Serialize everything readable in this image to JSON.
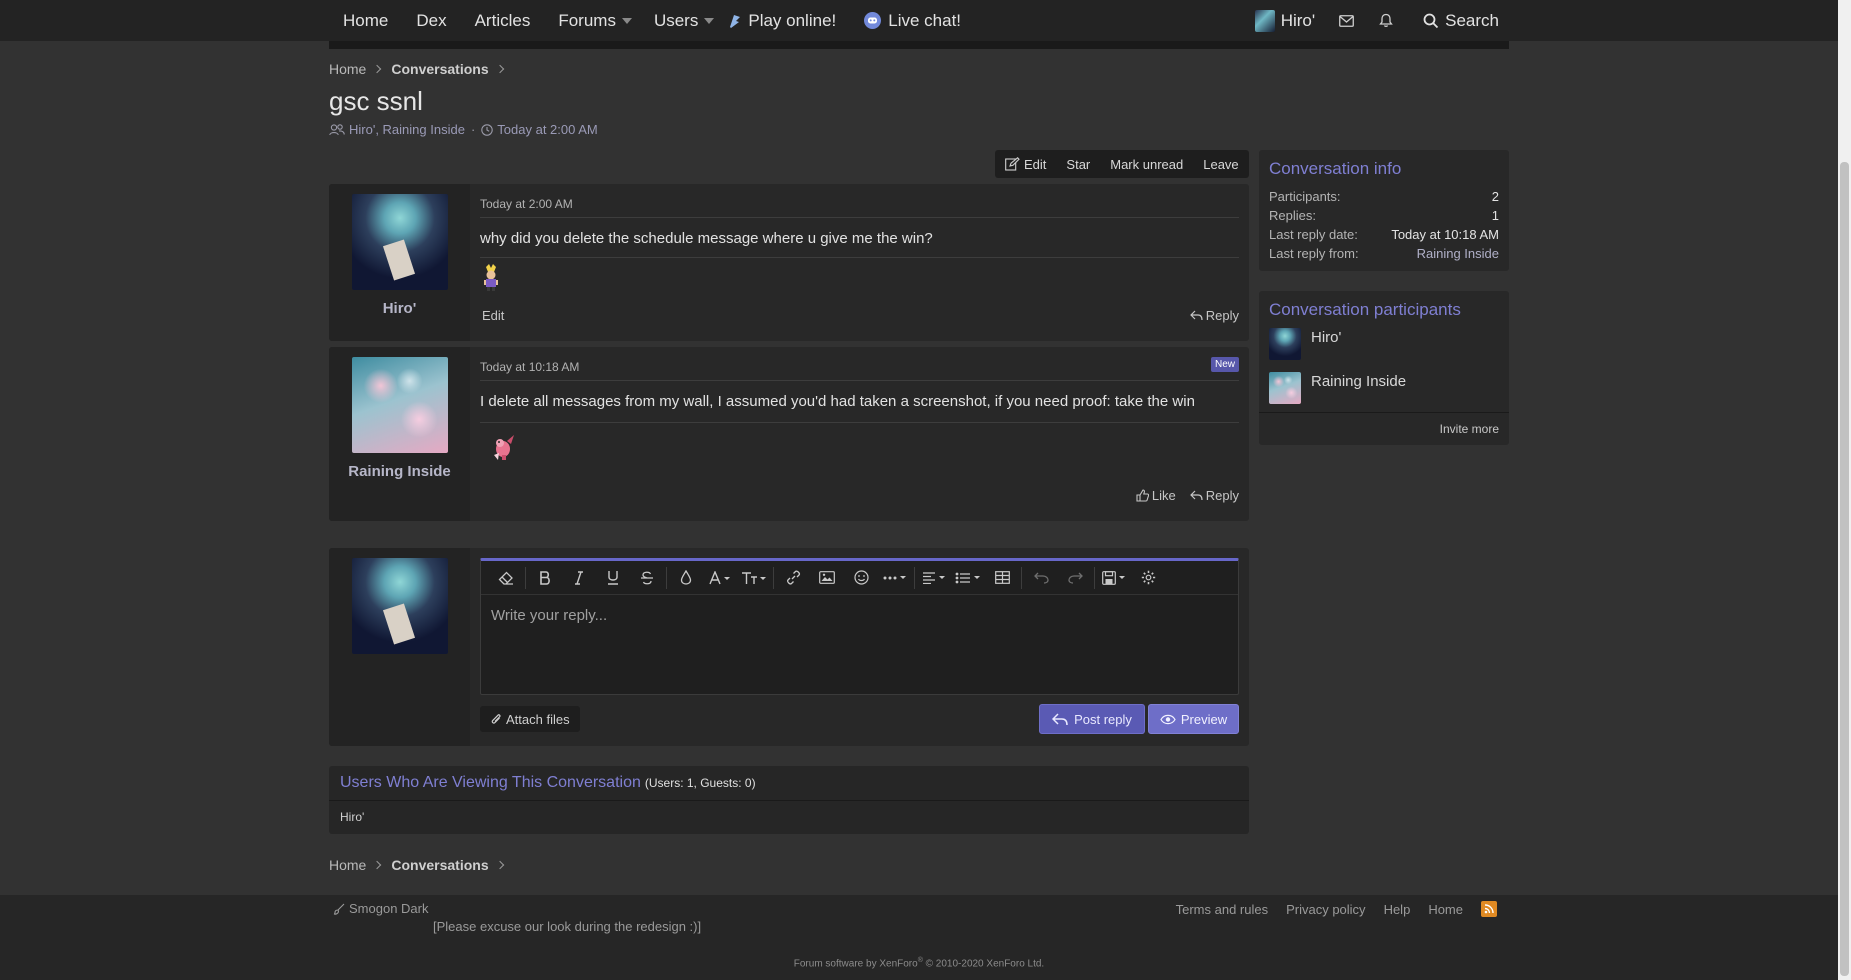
{
  "nav": {
    "items": [
      {
        "label": "Home"
      },
      {
        "label": "Dex"
      },
      {
        "label": "Articles"
      },
      {
        "label": "Forums"
      },
      {
        "label": "Users"
      },
      {
        "label": "Play online!"
      },
      {
        "label": "Live chat!"
      }
    ],
    "user": "Hiro'",
    "search_label": "Search"
  },
  "breadcrumbs": [
    "Home",
    "Conversations"
  ],
  "conversation": {
    "title": "gsc ssnl",
    "participants_text": "Hiro', Raining Inside",
    "date": "Today at 2:00 AM"
  },
  "actions": {
    "edit": "Edit",
    "star": "Star",
    "mark_unread": "Mark unread",
    "leave": "Leave"
  },
  "messages": [
    {
      "author": "Hiro'",
      "date": "Today at 2:00 AM",
      "text": "why did you delete the schedule message where u give me the win?",
      "edit_label": "Edit",
      "reply_label": "Reply"
    },
    {
      "author": "Raining Inside",
      "date": "Today at 10:18 AM",
      "badge": "New",
      "text": "I delete all messages from my wall, I assumed you'd had taken a screenshot, if you need proof: take the win",
      "like_label": "Like",
      "reply_label": "Reply"
    }
  ],
  "editor": {
    "placeholder": "Write your reply...",
    "attach_label": "Attach files",
    "post_label": "Post reply",
    "preview_label": "Preview",
    "toolbar": [
      "eraser-icon",
      "bold-icon",
      "italic-icon",
      "underline-icon",
      "strikethrough-icon",
      "color-icon",
      "font-family-icon",
      "font-size-icon",
      "link-icon",
      "image-icon",
      "smilie-icon",
      "more-icon",
      "align-icon",
      "list-icon",
      "table-icon",
      "undo-icon",
      "redo-icon",
      "drafts-icon",
      "settings-icon"
    ]
  },
  "viewing": {
    "title": "Users Who Are Viewing This Conversation",
    "summary": "(Users: 1, Guests: 0)",
    "users": "Hiro'"
  },
  "sidebar": {
    "info_title": "Conversation info",
    "info": [
      {
        "k": "Participants:",
        "v": "2"
      },
      {
        "k": "Replies:",
        "v": "1"
      },
      {
        "k": "Last reply date:",
        "v": "Today at 10:18 AM"
      },
      {
        "k": "Last reply from:",
        "v": "Raining Inside"
      }
    ],
    "participants_title": "Conversation participants",
    "participants": [
      "Hiro'",
      "Raining Inside"
    ],
    "invite_label": "Invite more"
  },
  "footer": {
    "style": "Smogon Dark",
    "note": "[Please excuse our look during the redesign :)]",
    "links": [
      "Terms and rules",
      "Privacy policy",
      "Help",
      "Home"
    ],
    "copyright_pre": "Forum software by XenForo",
    "copyright_sup": "®",
    "copyright_post": " © 2010-2020 XenForo Ltd."
  },
  "colors": {
    "accent": "#7f7fd2",
    "button": "#5a5ab4",
    "background": "#323232",
    "rss": "#e08a23"
  }
}
